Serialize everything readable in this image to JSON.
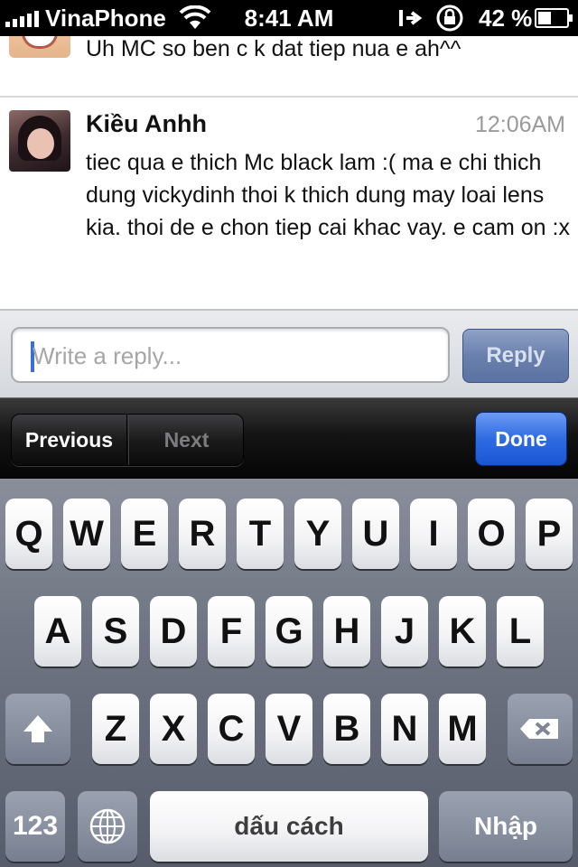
{
  "status_bar": {
    "carrier": "VinaPhone",
    "time": "8:41 AM",
    "battery_percent": "42 %",
    "icons": [
      "signal-icon",
      "wifi-icon",
      "location-arrow-icon",
      "rotation-lock-icon",
      "battery-icon"
    ]
  },
  "messages": [
    {
      "text": "Uh MC so ben c k dat tiep nua e ah^^"
    },
    {
      "author": "Kiều Anhh",
      "time": "12:06AM",
      "body": "tiec qua e thich Mc black lam :( ma e chi thich dung vickydinh thoi k thich dung may loai lens kia. thoi de e chon tiep cai khac vay. e cam on :x"
    }
  ],
  "reply": {
    "placeholder": "Write a reply...",
    "value": "",
    "button_label": "Reply"
  },
  "accessory": {
    "previous_label": "Previous",
    "next_label": "Next",
    "done_label": "Done"
  },
  "keyboard": {
    "row1": [
      "Q",
      "W",
      "E",
      "R",
      "T",
      "Y",
      "U",
      "I",
      "O",
      "P"
    ],
    "row2": [
      "A",
      "S",
      "D",
      "F",
      "G",
      "H",
      "J",
      "K",
      "L"
    ],
    "row3": [
      "Z",
      "X",
      "C",
      "V",
      "B",
      "N",
      "M"
    ],
    "numbers_label": "123",
    "space_label": "dấu cách",
    "return_label": "Nhập"
  },
  "colors": {
    "done_blue": "#2f6be0",
    "reply_button": "#6a80ad",
    "cursor": "#3a6fd8"
  }
}
